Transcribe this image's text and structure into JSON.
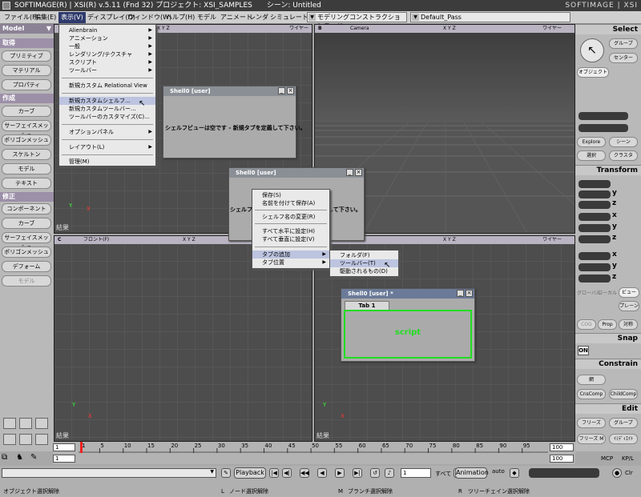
{
  "titlebar": {
    "title": "SOFTIMAGE(R) | XSI(R) v.5.11 (Fnd 32) プロジェクト: XSI_SAMPLES　　シーン: Untitled",
    "brand": "SOFTIMAGE | XSI"
  },
  "menubar": {
    "items": [
      "ファイル(F)",
      "編集(E)",
      "表示(V)",
      "ディスプレイ(D)",
      "ウィンドウ(W)",
      "ヘルプ(H)",
      "モデル",
      "アニメート",
      "レンダ",
      "シミュレート"
    ],
    "mode": "モデリングコンストラクションモード",
    "pass": "Default_Pass"
  },
  "left": {
    "module": "Model",
    "sections": {
      "get": "取得",
      "create": "作成",
      "modify": "修正"
    },
    "get_buttons": [
      "プリミティブ",
      "マテリアル",
      "プロパティ"
    ],
    "create_buttons": [
      "カーブ",
      "サーフェイスメッシュ",
      "ポリゴンメッシュ",
      "スケルトン",
      "モデル",
      "テキスト"
    ],
    "modify_buttons": [
      "コンポーネント",
      "カーブ",
      "サーフェイスメッシュ",
      "ポリゴンメッシュ",
      "デフォーム",
      "モデル"
    ]
  },
  "view_menu": {
    "items": [
      "Alienbrain",
      "アニメーション",
      "一般",
      "レンダリング/テクスチャ",
      "スクリプト",
      "ツールバー",
      "新規カスタム Relational View",
      "新規カスタムシェルフ...",
      "新規カスタムツールバー...",
      "ツールバーのカスタマイズ(C)...",
      "オプションパネル",
      "レイアウト(L)",
      "管理(M)"
    ]
  },
  "viewports": {
    "top_left": {
      "label": "結果"
    },
    "top_right": {
      "camera": "Camera",
      "mode": "ワイヤー"
    },
    "bottom_left": {
      "view": "フロント(F)",
      "label": "結果"
    },
    "bottom_right": {
      "mode": "ワイヤー",
      "label": "結果"
    },
    "xyz": "X Y Z",
    "mode_top_left": "ワイヤー"
  },
  "shell1": {
    "title": "Shell0 [user]",
    "message": "シェルフビューは空です - 新規タブを定義して下さい。"
  },
  "shell2": {
    "title": "Shell0 [user]",
    "message_left": "シェルフビ",
    "message_right": "して下さい。"
  },
  "context_menu": {
    "items": [
      "保存(S)",
      "名前を付けて保存(A)",
      "シェルフ名の変更(R)",
      "すべて水平に設定(H)",
      "すべて垂直に設定(V)",
      "タブの追加",
      "タブ位置"
    ]
  },
  "tab_submenu": {
    "items": [
      "フォルダ(F)",
      "ツールバー(T)",
      "駆動されるもの(D)"
    ]
  },
  "shell3": {
    "title": "Shell0 [user] *",
    "tab": "Tab 1",
    "content": "script"
  },
  "right": {
    "select": "Select",
    "group": "グループ",
    "center": "センター",
    "object": "オブジェクト",
    "explore": "Explore",
    "scene": "シーン",
    "selection": "選択",
    "class": "クラスタ",
    "transform": "Transform",
    "xyz": [
      "x",
      "y",
      "z"
    ],
    "global": "グローバル",
    "local": "ローカル",
    "view": "ビュー",
    "plane": "プレーン",
    "cog": "COG",
    "prop": "Prop",
    "sym": "対称",
    "snap": "Snap",
    "on": "ON",
    "constrain": "Constrain",
    "constrain_btn": "網",
    "cnscomp": "CnsComp",
    "childcomp": "ChildComp",
    "edit": "Edit",
    "freeze": "フリーズ",
    "group_btn": "グループ",
    "freezem": "フリーズ M",
    "immed": "ｲﾐﾃﾞｨｴｲﾄ",
    "mcp": "MCP",
    "kpl": "KP/L"
  },
  "timeline": {
    "start": "1",
    "end": "100",
    "end2": "100",
    "ticks": [
      "1",
      "5",
      "10",
      "15",
      "20",
      "25",
      "30",
      "35",
      "40",
      "45",
      "50",
      "55",
      "60",
      "65",
      "70",
      "75",
      "80",
      "85",
      "90",
      "95"
    ],
    "cur": "1"
  },
  "playback": {
    "playback": "Playback",
    "all": "すべて",
    "animation": "Animation",
    "auto": "auto"
  },
  "status": {
    "left": "オブジェクト選択解除",
    "l": "ノード選択解除",
    "m": "ブランチ選択解除",
    "r": "ツリーチェイン選択解除"
  },
  "colors": {
    "accent": "#2e3a6c",
    "script_green": "#22dd22",
    "section": "#9c8fa8"
  }
}
